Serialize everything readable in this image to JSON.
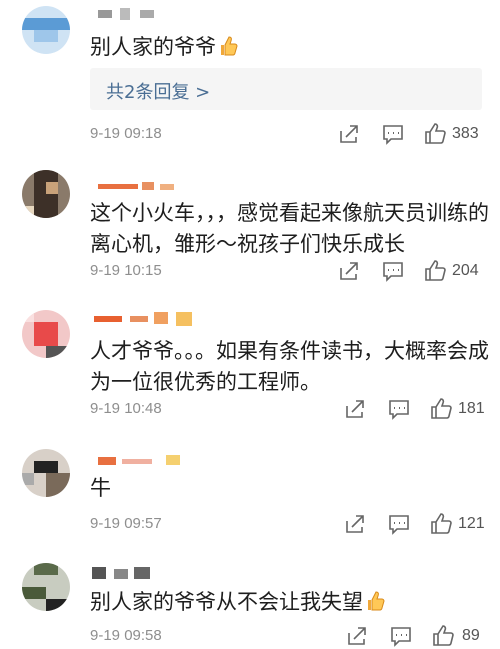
{
  "comments": [
    {
      "text": "别人家的爷爷",
      "time": "9-19 09:18",
      "likes": "383",
      "reply_label": "共2条回复 >"
    },
    {
      "text": "这个小火车，，，感觉看起来像航天员训练的\n离心机，雏形～祝孩子们快乐成长",
      "time": "9-19 10:15",
      "likes": "204"
    },
    {
      "text": "人才爷爷。。。如果有条件读书，大概率会成\n为一位很优秀的工程师。",
      "time": "9-19 10:48",
      "likes": "181"
    },
    {
      "text": "牛",
      "time": "9-19 09:57",
      "likes": "121"
    },
    {
      "text": "别人家的爷爷从不会让我失望",
      "time": "9-19 09:58",
      "likes": "89"
    }
  ],
  "icons": {
    "share": "share-icon",
    "comment": "comment-icon",
    "like": "thumbs-up-icon"
  },
  "colors": {
    "link": "#4a6e94",
    "meta": "#8e8e8e",
    "reply_bg": "#f5f5f5"
  }
}
